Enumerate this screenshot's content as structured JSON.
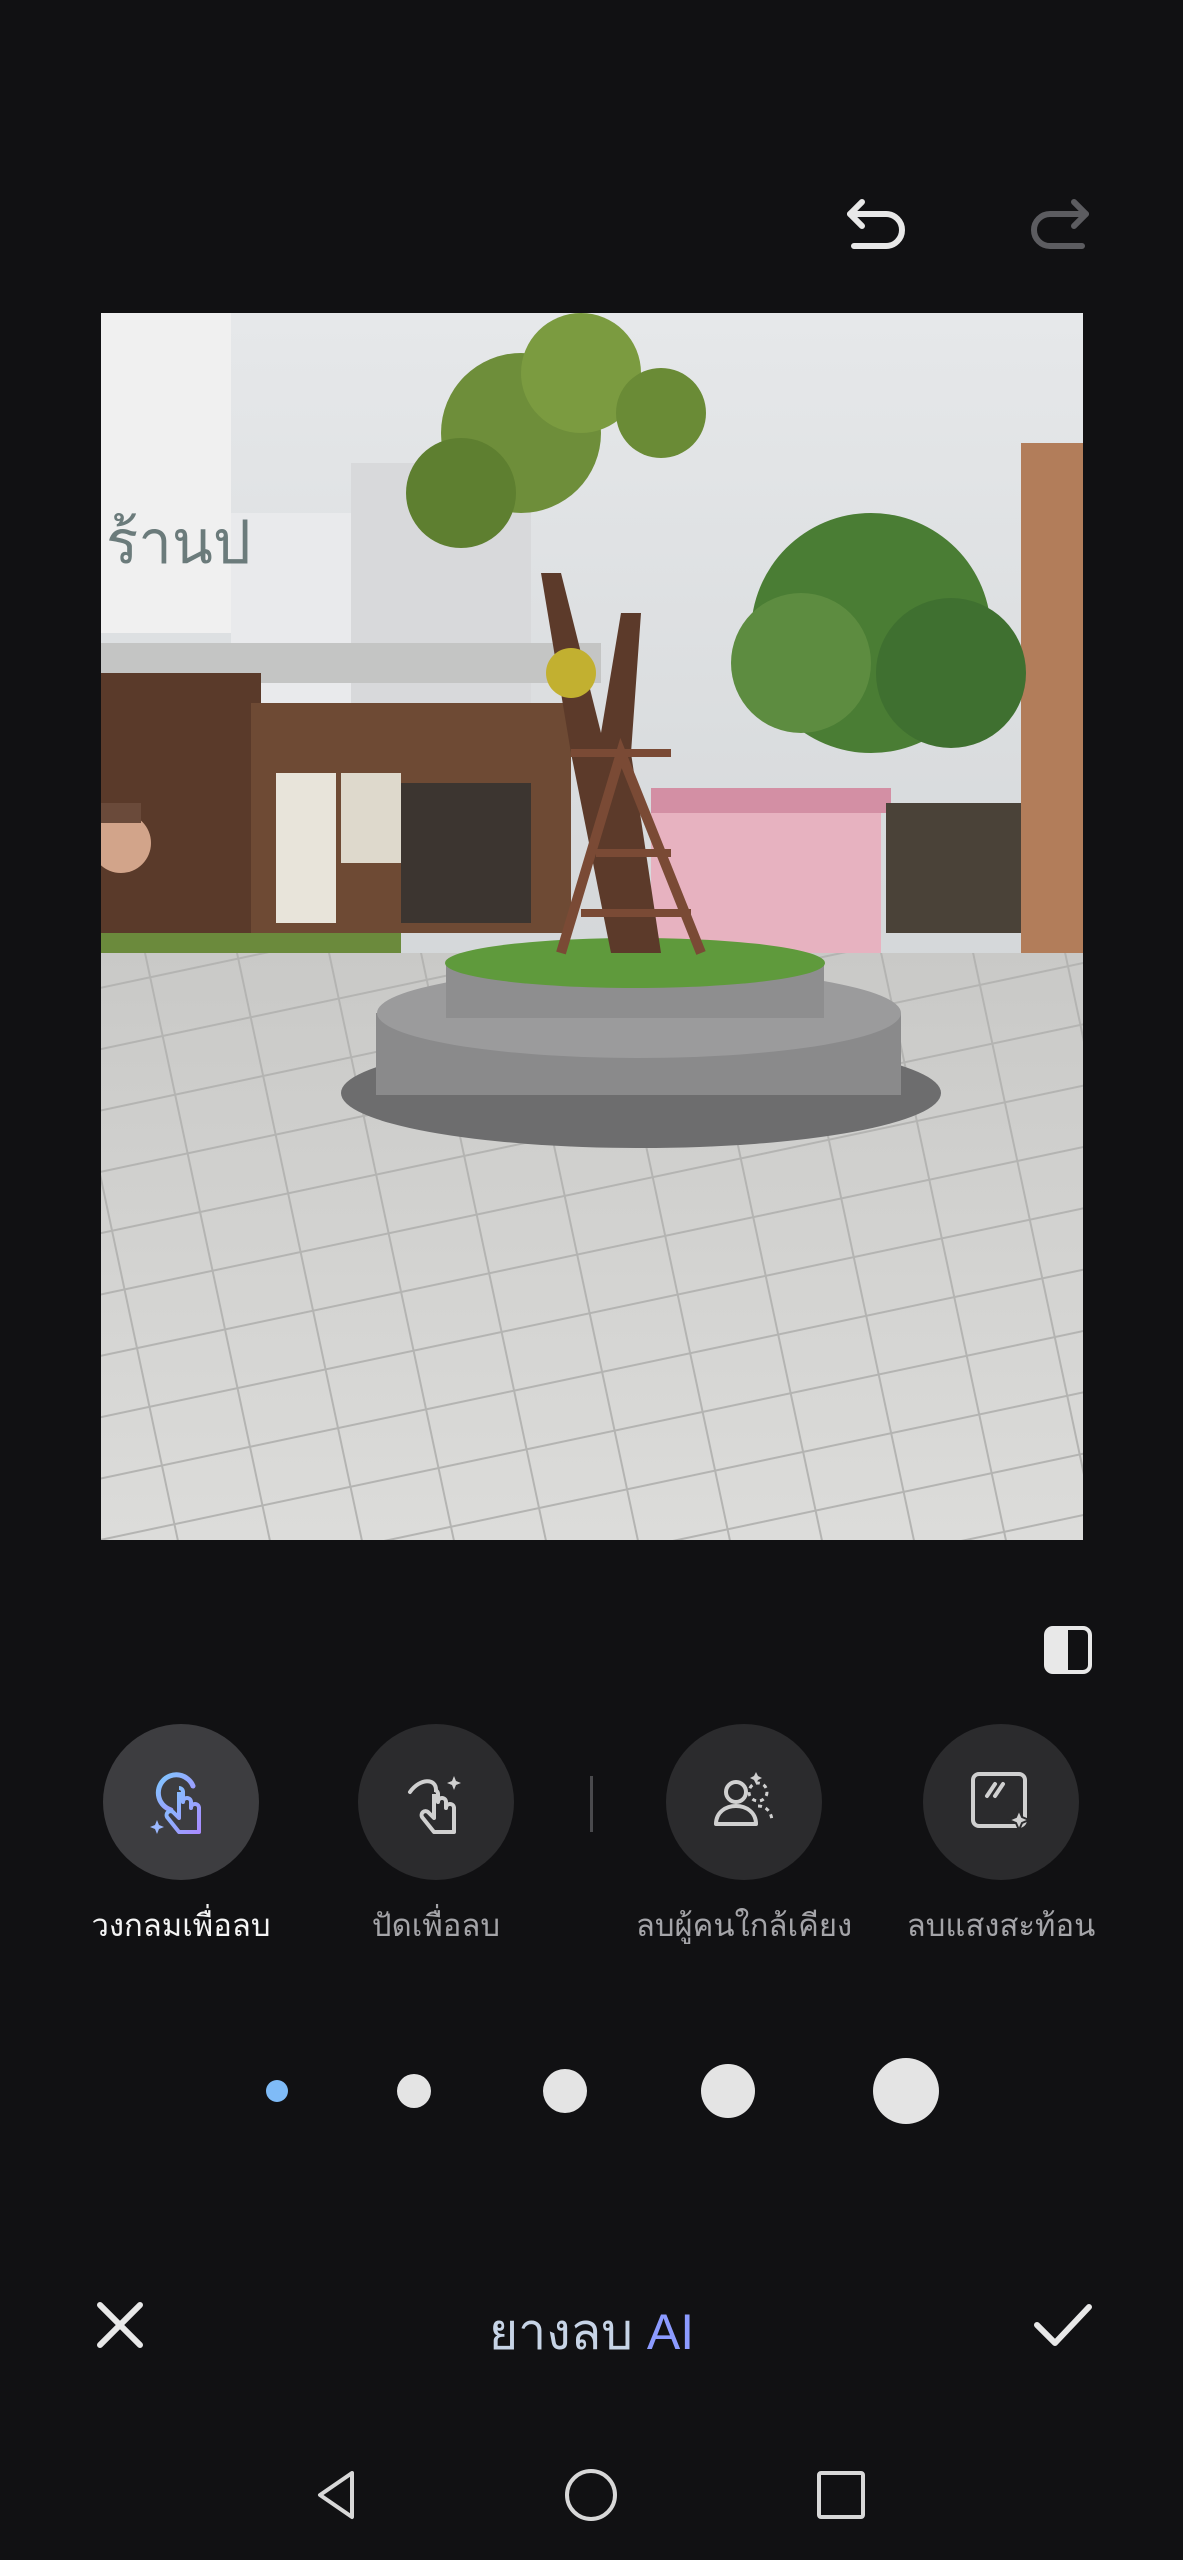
{
  "toolbar": {
    "undo_icon": "undo-icon",
    "redo_icon": "redo-icon",
    "compare_icon": "compare-icon"
  },
  "tools": [
    {
      "label": "วงกลมเพื่อลบ",
      "icon": "circle-erase-icon",
      "active": true
    },
    {
      "label": "ปัดเพื่อลบ",
      "icon": "brush-erase-icon",
      "active": false
    },
    {
      "label": "ลบผู้คนใกล้เคียง",
      "icon": "remove-people-icon",
      "active": false
    },
    {
      "label": "ลบแสงสะท้อน",
      "icon": "remove-reflection-icon",
      "active": false
    }
  ],
  "brush_sizes": {
    "count": 5,
    "selected_index": 0,
    "accent_color": "#7fbbf7"
  },
  "bottom_bar": {
    "title_thai": "ยางลบ ",
    "title_ai": "AI",
    "close_icon": "close-icon",
    "confirm_icon": "checkmark-icon"
  },
  "system_nav": [
    "back-icon",
    "home-icon",
    "recents-icon"
  ],
  "colors": {
    "background": "#111113",
    "tool_bg": "#2b2b2d",
    "title_gradient_start": "#c7d4e6",
    "title_gradient_end": "#8c9bff"
  }
}
